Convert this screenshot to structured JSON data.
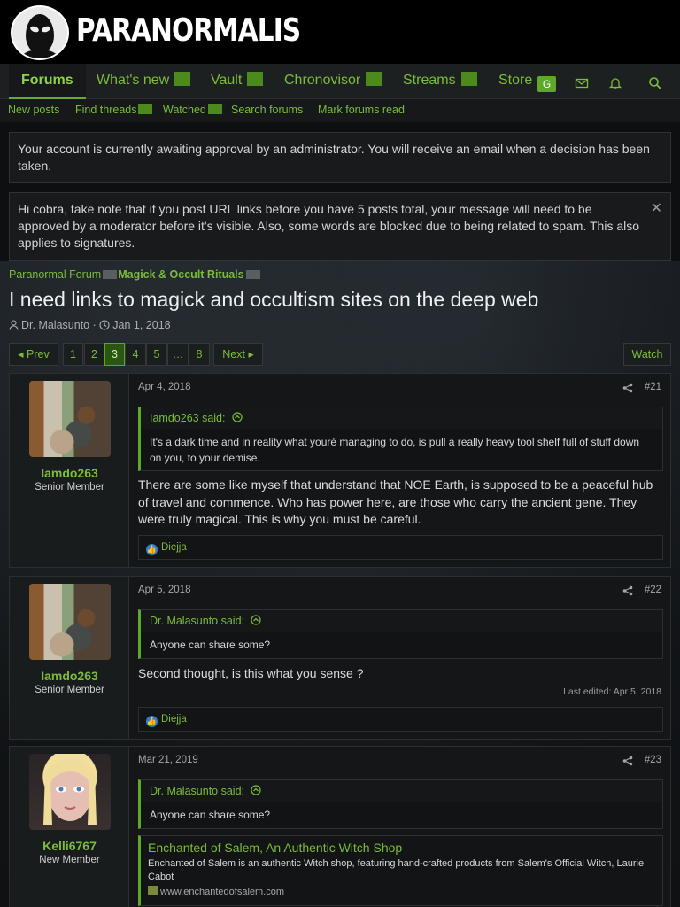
{
  "site": {
    "name": "PARANORMALIS"
  },
  "nav": {
    "tabs": [
      {
        "label": "Forums"
      },
      {
        "label": "What's new"
      },
      {
        "label": "Vault"
      },
      {
        "label": "Chronovisor"
      },
      {
        "label": "Streams"
      },
      {
        "label": "Store"
      }
    ],
    "badge": "G"
  },
  "subnav": {
    "items": [
      {
        "label": "New posts"
      },
      {
        "label": "Find threads"
      },
      {
        "label": "Watched"
      },
      {
        "label": "Search forums"
      },
      {
        "label": "Mark forums read"
      }
    ]
  },
  "notices": {
    "approval": "Your account is currently awaiting approval by an administrator. You will receive an email when a decision has been taken.",
    "url_warning": "Hi cobra, take note that if you post URL links before you have 5 posts total, your message will need to be approved by a moderator before it's visible. Also, some words are blocked due to being related to spam. This also applies to signatures.",
    "close": "✕"
  },
  "breadcrumb": {
    "parent": "Paranormal Forum",
    "current": "Magick & Occult Rituals"
  },
  "thread": {
    "title": "I need links to magick and occultism sites on the deep web",
    "author": "Dr. Malasunto",
    "date": "Jan 1, 2018",
    "separator": "·"
  },
  "pagination": {
    "prev": "◂ Prev",
    "pages": [
      "1",
      "2",
      "3",
      "4",
      "5",
      "…",
      "8"
    ],
    "current_page": "3",
    "next": "Next ▸",
    "watch": "Watch"
  },
  "posts": [
    {
      "username": "Iamdo263",
      "user_title": "Senior Member",
      "date": "Apr 4, 2018",
      "number": "#21",
      "quote_author": "Iamdo263 said:",
      "quote_text": "It's a dark time and in reality what youré managing to do, is pull a really heavy tool shelf full of stuff down on you, to your demise.",
      "text": "There are some like myself that understand that NOE Earth, is supposed to be a peaceful hub of travel and commence. Who has power here, are those who carry the ancient gene. They were truly magical. This is why you must be careful.",
      "reaction_user": "Diejja"
    },
    {
      "username": "Iamdo263",
      "user_title": "Senior Member",
      "date": "Apr 5, 2018",
      "number": "#22",
      "quote_author": "Dr. Malasunto said:",
      "quote_text": "Anyone can share some?",
      "text": "Second thought, is this what you sense ?",
      "last_edited": "Last edited: Apr 5, 2018",
      "reaction_user": "Diejja"
    },
    {
      "username": "Kelli6767",
      "user_title": "New Member",
      "date": "Mar 21, 2019",
      "number": "#23",
      "quote_author": "Dr. Malasunto said:",
      "quote_text": "Anyone can share some?",
      "embed_title": "Enchanted of Salem, An Authentic Witch Shop",
      "embed_desc": "Enchanted of Salem is an authentic Witch shop, featuring hand-crafted products from Salem's Official Witch, Laurie Cabot",
      "embed_url": "www.enchantedofsalem.com"
    }
  ],
  "icons": {
    "quote_up": "up-arrow-circle-icon",
    "share": "share-icon",
    "like": "like-icon",
    "user": "user-icon",
    "clock": "clock-icon",
    "mail": "mail-icon",
    "bell": "bell-icon",
    "search": "search-icon"
  },
  "colors": {
    "accent": "#7bbd3a",
    "accent_dark": "#4c8a1e",
    "background": "#0d0f10"
  }
}
